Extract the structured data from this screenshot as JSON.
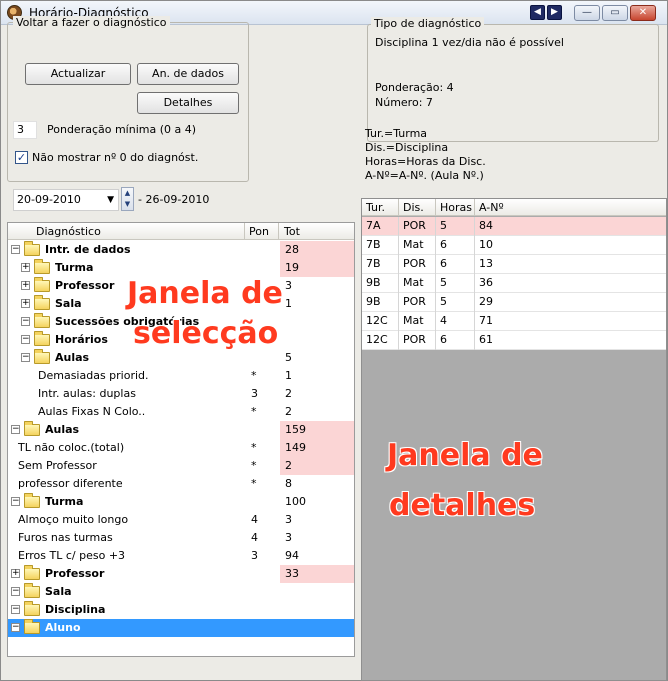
{
  "window": {
    "title": "Horário-Diagnóstico",
    "nav": [
      "◀",
      "▶"
    ],
    "controls": [
      "—",
      "▭",
      "✕"
    ]
  },
  "left": {
    "group_title": "Voltar a fazer o diagnóstico",
    "buttons": {
      "update": "Actualizar",
      "analysis": "An. de dados",
      "details": "Detalhes"
    },
    "min_weight_value": "3",
    "min_weight_label": "Ponderação mínima (0 a 4)",
    "hide_zero_label": "Não mostrar nº 0 do diagnóst.",
    "hide_zero_checked": true,
    "date_from": "20-09-2010",
    "date_to": "- 26-09-2010",
    "overlay_line1": "Janela de",
    "overlay_line2": "selecção"
  },
  "tree": {
    "columns": [
      "Diagnóstico",
      "Pon",
      "Tot"
    ],
    "rows": [
      {
        "label": "Intr. de dados",
        "pon": "",
        "tot": "28",
        "level": 0,
        "exp": "−",
        "folder": true,
        "bold": true,
        "hl": true
      },
      {
        "label": "Turma",
        "pon": "",
        "tot": "19",
        "level": 1,
        "exp": "+",
        "folder": true,
        "bold": true,
        "hl": true
      },
      {
        "label": "Professor",
        "pon": "",
        "tot": "3",
        "level": 1,
        "exp": "+",
        "folder": true,
        "bold": true,
        "hl": false
      },
      {
        "label": "Sala",
        "pon": "",
        "tot": "1",
        "level": 1,
        "exp": "+",
        "folder": true,
        "bold": true,
        "hl": false
      },
      {
        "label": "Sucessões obrigatórias",
        "pon": "",
        "tot": "",
        "level": 1,
        "exp": "−",
        "folder": true,
        "bold": true,
        "hl": false
      },
      {
        "label": "Horários",
        "pon": "",
        "tot": "",
        "level": 1,
        "exp": "−",
        "folder": true,
        "bold": true,
        "hl": false
      },
      {
        "label": "Aulas",
        "pon": "",
        "tot": "5",
        "level": 1,
        "exp": "−",
        "folder": true,
        "bold": true,
        "hl": false
      },
      {
        "label": "Demasiadas priorid.",
        "pon": "*",
        "tot": "1",
        "level": 2,
        "exp": "",
        "folder": false,
        "bold": false,
        "hl": false
      },
      {
        "label": "Intr. aulas: duplas",
        "pon": "3",
        "tot": "2",
        "level": 2,
        "exp": "",
        "folder": false,
        "bold": false,
        "hl": false
      },
      {
        "label": "Aulas Fixas N Colo..",
        "pon": "*",
        "tot": "2",
        "level": 2,
        "exp": "",
        "folder": false,
        "bold": false,
        "hl": false
      },
      {
        "label": "Aulas",
        "pon": "",
        "tot": "159",
        "level": 0,
        "exp": "−",
        "folder": true,
        "bold": true,
        "hl": true
      },
      {
        "label": "TL não coloc.(total)",
        "pon": "*",
        "tot": "149",
        "level": 0,
        "exp": "",
        "folder": false,
        "bold": false,
        "hl": true
      },
      {
        "label": "Sem Professor",
        "pon": "*",
        "tot": "2",
        "level": 0,
        "exp": "",
        "folder": false,
        "bold": false,
        "hl": true
      },
      {
        "label": "professor diferente",
        "pon": "*",
        "tot": "8",
        "level": 0,
        "exp": "",
        "folder": false,
        "bold": false,
        "hl": false
      },
      {
        "label": "Turma",
        "pon": "",
        "tot": "100",
        "level": 0,
        "exp": "−",
        "folder": true,
        "bold": true,
        "hl": false
      },
      {
        "label": "Almoço muito longo",
        "pon": "4",
        "tot": "3",
        "level": 0,
        "exp": "",
        "folder": false,
        "bold": false,
        "hl": false
      },
      {
        "label": "Furos nas turmas",
        "pon": "4",
        "tot": "3",
        "level": 0,
        "exp": "",
        "folder": false,
        "bold": false,
        "hl": false
      },
      {
        "label": "Erros TL c/ peso +3",
        "pon": "3",
        "tot": "94",
        "level": 0,
        "exp": "",
        "folder": false,
        "bold": false,
        "hl": false
      },
      {
        "label": "Professor",
        "pon": "",
        "tot": "33",
        "level": 0,
        "exp": "+",
        "folder": true,
        "bold": true,
        "hl": true
      },
      {
        "label": "Sala",
        "pon": "",
        "tot": "",
        "level": 0,
        "exp": "−",
        "folder": true,
        "bold": true,
        "hl": false
      },
      {
        "label": "Disciplina",
        "pon": "",
        "tot": "",
        "level": 0,
        "exp": "−",
        "folder": true,
        "bold": true,
        "hl": false
      },
      {
        "label": "Aluno",
        "pon": "",
        "tot": "",
        "level": 0,
        "exp": "−",
        "folder": true,
        "bold": true,
        "hl": false,
        "selected": true
      }
    ]
  },
  "right": {
    "tipo_title": "Tipo de diagnóstico",
    "tipo_desc": "Disciplina 1 vez/dia não é possível",
    "ponderacao": "Ponderação: 4",
    "numero": "Número: 7",
    "legend": [
      "Tur.=Turma",
      "Dis.=Disciplina",
      "Horas=Horas da Disc.",
      "A-Nº=A-Nº. (Aula Nº.)"
    ],
    "overlay_line1": "Janela de",
    "overlay_line2": "detalhes"
  },
  "detail": {
    "columns": [
      "Tur.",
      "Dis.",
      "Horas",
      "A-Nº"
    ],
    "rows": [
      {
        "tur": "7A",
        "dis": "POR",
        "horas": "5",
        "an": "84",
        "hl": true
      },
      {
        "tur": "7B",
        "dis": "Mat",
        "horas": "6",
        "an": "10",
        "hl": false
      },
      {
        "tur": "7B",
        "dis": "POR",
        "horas": "6",
        "an": "13",
        "hl": false
      },
      {
        "tur": "9B",
        "dis": "Mat",
        "horas": "5",
        "an": "36",
        "hl": false
      },
      {
        "tur": "9B",
        "dis": "POR",
        "horas": "5",
        "an": "29",
        "hl": false
      },
      {
        "tur": "12C",
        "dis": "Mat",
        "horas": "4",
        "an": "71",
        "hl": false
      },
      {
        "tur": "12C",
        "dis": "POR",
        "horas": "6",
        "an": "61",
        "hl": false
      }
    ]
  },
  "colors": {
    "highlight": "#fbd5d5",
    "selection": "#3399ff",
    "overlay": "#ff3a1f",
    "detail_bg": "#ababab"
  }
}
